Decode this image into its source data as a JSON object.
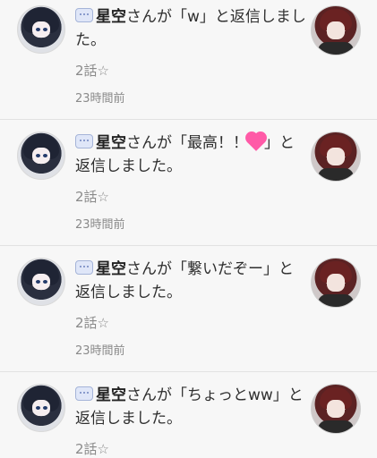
{
  "items": [
    {
      "prefix": "星空",
      "msg": "さんが「w」と返信しました。",
      "chapter": "2話☆",
      "time": "23時間前"
    },
    {
      "prefix": "星空",
      "msg_a": "さんが「最高！！",
      "msg_b": "」と返信しました。",
      "chapter": "2話☆",
      "time": "23時間前"
    },
    {
      "prefix": "星空",
      "msg": "さんが「繋いだぞー」と返信しました。",
      "chapter": "2話☆",
      "time": "23時間前"
    },
    {
      "prefix": "星空",
      "msg": "さんが「ちょっとww」と返信しました。",
      "chapter": "2話☆",
      "time": ""
    }
  ]
}
